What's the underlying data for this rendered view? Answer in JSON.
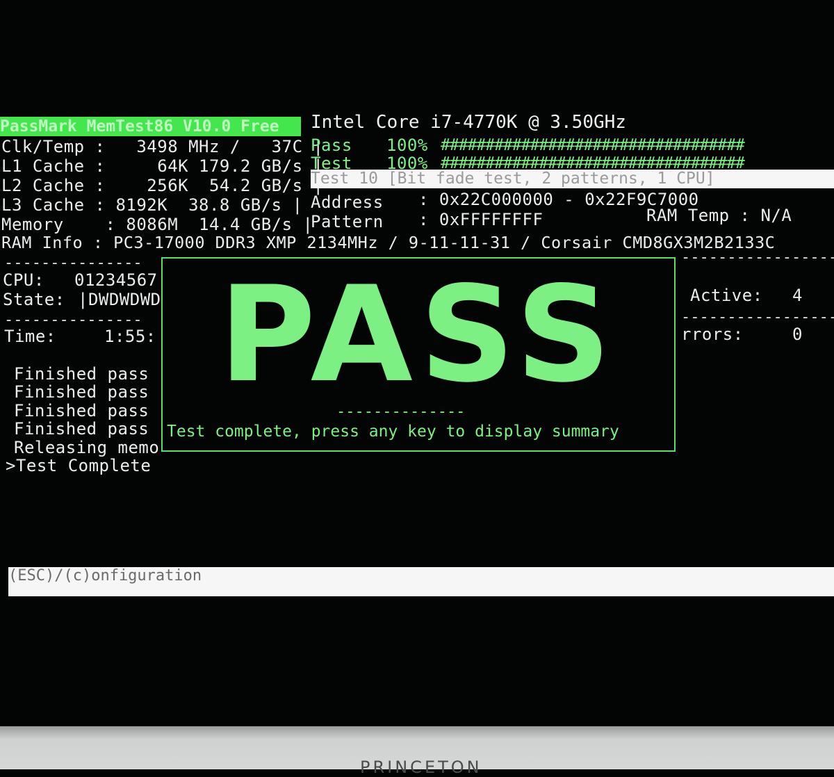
{
  "header": {
    "app_title": "PassMark MemTest86 V10.0 Free",
    "cpu_name": "Intel Core i7-4770K @ 3.50GHz"
  },
  "system": {
    "clk_temp": "Clk/Temp :   3498 MHz /   37C |",
    "l1": "L1 Cache :     64K 179.2 GB/s |",
    "l2": "L2 Cache :    256K  54.2 GB/s |",
    "l3": "L3 Cache : 8192K  38.8 GB/s |",
    "memory": "Memory    : 8086M  14.4 GB/s |",
    "ram_info": "RAM Info : PC3-17000 DDR3 XMP 2134MHz / 9-11-11-31 / Corsair CMD8GX3M2B2133C"
  },
  "progress": {
    "pass_label": "Pass",
    "pass_pct": "100%",
    "pass_fraction": 1.0,
    "test_label": "Test",
    "test_pct": "100%",
    "test_fraction": 1.0,
    "hashes": "##################################"
  },
  "current": {
    "test_desc": "Test 10 [Bit fade test, 2 patterns, 1 CPU]",
    "address_label": "Address",
    "address_value": ": 0x22C000000 - 0x22F9C7000",
    "pattern_label": "Pattern",
    "pattern_value": ": 0xFFFFFFFF",
    "ram_temp": "RAM Temp : N/A"
  },
  "left_panel": {
    "dashes": "---------------",
    "cpu_label": "CPU:",
    "cpu_value": "01234567",
    "state_label": "State:",
    "state_value": "|DWDWDWD",
    "time_label": "Time:",
    "time_value": "1:55:",
    "log": [
      "Finished pass",
      "Finished pass",
      "Finished pass",
      "Finished pass",
      "Releasing memo",
      ">Test Complete"
    ]
  },
  "right_panel": {
    "dashes": "--------------------",
    "active_label": "Active:",
    "active_value": "4",
    "errors_label": "rrors:",
    "errors_value": "0"
  },
  "result_box": {
    "result": "PASS",
    "separator": "--------------",
    "message": "Test complete, press any key to display summary"
  },
  "footer": {
    "menu": "(ESC)/(c)onfiguration"
  },
  "monitor": {
    "brand": "PRINCETON"
  },
  "colors": {
    "accent_green": "#7cf083",
    "title_bg": "#44e64e",
    "background": "#030404"
  }
}
